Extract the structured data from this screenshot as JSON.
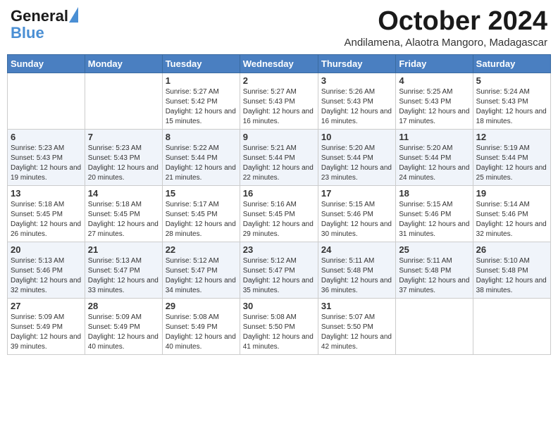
{
  "logo": {
    "line1": "General",
    "line2": "Blue"
  },
  "title": "October 2024",
  "subtitle": "Andilamena, Alaotra Mangoro, Madagascar",
  "days": [
    "Sunday",
    "Monday",
    "Tuesday",
    "Wednesday",
    "Thursday",
    "Friday",
    "Saturday"
  ],
  "weeks": [
    [
      {
        "day": "",
        "sunrise": "",
        "sunset": "",
        "daylight": ""
      },
      {
        "day": "",
        "sunrise": "",
        "sunset": "",
        "daylight": ""
      },
      {
        "day": "1",
        "sunrise": "Sunrise: 5:27 AM",
        "sunset": "Sunset: 5:42 PM",
        "daylight": "Daylight: 12 hours and 15 minutes."
      },
      {
        "day": "2",
        "sunrise": "Sunrise: 5:27 AM",
        "sunset": "Sunset: 5:43 PM",
        "daylight": "Daylight: 12 hours and 16 minutes."
      },
      {
        "day": "3",
        "sunrise": "Sunrise: 5:26 AM",
        "sunset": "Sunset: 5:43 PM",
        "daylight": "Daylight: 12 hours and 16 minutes."
      },
      {
        "day": "4",
        "sunrise": "Sunrise: 5:25 AM",
        "sunset": "Sunset: 5:43 PM",
        "daylight": "Daylight: 12 hours and 17 minutes."
      },
      {
        "day": "5",
        "sunrise": "Sunrise: 5:24 AM",
        "sunset": "Sunset: 5:43 PM",
        "daylight": "Daylight: 12 hours and 18 minutes."
      }
    ],
    [
      {
        "day": "6",
        "sunrise": "Sunrise: 5:23 AM",
        "sunset": "Sunset: 5:43 PM",
        "daylight": "Daylight: 12 hours and 19 minutes."
      },
      {
        "day": "7",
        "sunrise": "Sunrise: 5:23 AM",
        "sunset": "Sunset: 5:43 PM",
        "daylight": "Daylight: 12 hours and 20 minutes."
      },
      {
        "day": "8",
        "sunrise": "Sunrise: 5:22 AM",
        "sunset": "Sunset: 5:44 PM",
        "daylight": "Daylight: 12 hours and 21 minutes."
      },
      {
        "day": "9",
        "sunrise": "Sunrise: 5:21 AM",
        "sunset": "Sunset: 5:44 PM",
        "daylight": "Daylight: 12 hours and 22 minutes."
      },
      {
        "day": "10",
        "sunrise": "Sunrise: 5:20 AM",
        "sunset": "Sunset: 5:44 PM",
        "daylight": "Daylight: 12 hours and 23 minutes."
      },
      {
        "day": "11",
        "sunrise": "Sunrise: 5:20 AM",
        "sunset": "Sunset: 5:44 PM",
        "daylight": "Daylight: 12 hours and 24 minutes."
      },
      {
        "day": "12",
        "sunrise": "Sunrise: 5:19 AM",
        "sunset": "Sunset: 5:44 PM",
        "daylight": "Daylight: 12 hours and 25 minutes."
      }
    ],
    [
      {
        "day": "13",
        "sunrise": "Sunrise: 5:18 AM",
        "sunset": "Sunset: 5:45 PM",
        "daylight": "Daylight: 12 hours and 26 minutes."
      },
      {
        "day": "14",
        "sunrise": "Sunrise: 5:18 AM",
        "sunset": "Sunset: 5:45 PM",
        "daylight": "Daylight: 12 hours and 27 minutes."
      },
      {
        "day": "15",
        "sunrise": "Sunrise: 5:17 AM",
        "sunset": "Sunset: 5:45 PM",
        "daylight": "Daylight: 12 hours and 28 minutes."
      },
      {
        "day": "16",
        "sunrise": "Sunrise: 5:16 AM",
        "sunset": "Sunset: 5:45 PM",
        "daylight": "Daylight: 12 hours and 29 minutes."
      },
      {
        "day": "17",
        "sunrise": "Sunrise: 5:15 AM",
        "sunset": "Sunset: 5:46 PM",
        "daylight": "Daylight: 12 hours and 30 minutes."
      },
      {
        "day": "18",
        "sunrise": "Sunrise: 5:15 AM",
        "sunset": "Sunset: 5:46 PM",
        "daylight": "Daylight: 12 hours and 31 minutes."
      },
      {
        "day": "19",
        "sunrise": "Sunrise: 5:14 AM",
        "sunset": "Sunset: 5:46 PM",
        "daylight": "Daylight: 12 hours and 32 minutes."
      }
    ],
    [
      {
        "day": "20",
        "sunrise": "Sunrise: 5:13 AM",
        "sunset": "Sunset: 5:46 PM",
        "daylight": "Daylight: 12 hours and 32 minutes."
      },
      {
        "day": "21",
        "sunrise": "Sunrise: 5:13 AM",
        "sunset": "Sunset: 5:47 PM",
        "daylight": "Daylight: 12 hours and 33 minutes."
      },
      {
        "day": "22",
        "sunrise": "Sunrise: 5:12 AM",
        "sunset": "Sunset: 5:47 PM",
        "daylight": "Daylight: 12 hours and 34 minutes."
      },
      {
        "day": "23",
        "sunrise": "Sunrise: 5:12 AM",
        "sunset": "Sunset: 5:47 PM",
        "daylight": "Daylight: 12 hours and 35 minutes."
      },
      {
        "day": "24",
        "sunrise": "Sunrise: 5:11 AM",
        "sunset": "Sunset: 5:48 PM",
        "daylight": "Daylight: 12 hours and 36 minutes."
      },
      {
        "day": "25",
        "sunrise": "Sunrise: 5:11 AM",
        "sunset": "Sunset: 5:48 PM",
        "daylight": "Daylight: 12 hours and 37 minutes."
      },
      {
        "day": "26",
        "sunrise": "Sunrise: 5:10 AM",
        "sunset": "Sunset: 5:48 PM",
        "daylight": "Daylight: 12 hours and 38 minutes."
      }
    ],
    [
      {
        "day": "27",
        "sunrise": "Sunrise: 5:09 AM",
        "sunset": "Sunset: 5:49 PM",
        "daylight": "Daylight: 12 hours and 39 minutes."
      },
      {
        "day": "28",
        "sunrise": "Sunrise: 5:09 AM",
        "sunset": "Sunset: 5:49 PM",
        "daylight": "Daylight: 12 hours and 40 minutes."
      },
      {
        "day": "29",
        "sunrise": "Sunrise: 5:08 AM",
        "sunset": "Sunset: 5:49 PM",
        "daylight": "Daylight: 12 hours and 40 minutes."
      },
      {
        "day": "30",
        "sunrise": "Sunrise: 5:08 AM",
        "sunset": "Sunset: 5:50 PM",
        "daylight": "Daylight: 12 hours and 41 minutes."
      },
      {
        "day": "31",
        "sunrise": "Sunrise: 5:07 AM",
        "sunset": "Sunset: 5:50 PM",
        "daylight": "Daylight: 12 hours and 42 minutes."
      },
      {
        "day": "",
        "sunrise": "",
        "sunset": "",
        "daylight": ""
      },
      {
        "day": "",
        "sunrise": "",
        "sunset": "",
        "daylight": ""
      }
    ]
  ]
}
